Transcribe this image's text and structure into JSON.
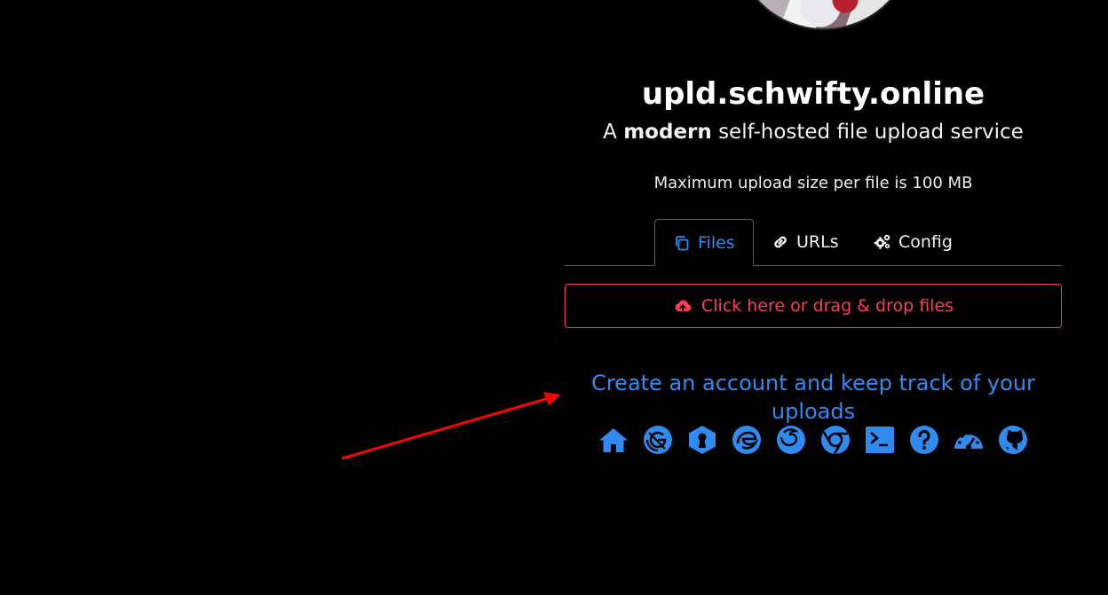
{
  "site": {
    "title": "upld.schwifty.online",
    "tagline_prefix": "A ",
    "tagline_bold": "modern",
    "tagline_suffix": " self-hosted file upload service",
    "max_upload_text": "Maximum upload size per file is 100 MB"
  },
  "tabs": [
    {
      "label": "Files",
      "icon": "copy-icon",
      "active": true
    },
    {
      "label": "URLs",
      "icon": "link-icon",
      "active": false
    },
    {
      "label": "Config",
      "icon": "gears-icon",
      "active": false
    }
  ],
  "upload": {
    "label": "Click here or drag & drop files",
    "icon": "cloud-upload-icon"
  },
  "account_link": {
    "label": "Create an account and keep track of your uploads"
  },
  "quick_links": [
    {
      "icon": "home-icon"
    },
    {
      "icon": "gatsby-icon"
    },
    {
      "icon": "keybase-icon"
    },
    {
      "icon": "edge-icon"
    },
    {
      "icon": "firefox-icon"
    },
    {
      "icon": "chrome-icon"
    },
    {
      "icon": "terminal-icon"
    },
    {
      "icon": "question-icon"
    },
    {
      "icon": "dashboard-icon"
    },
    {
      "icon": "github-icon"
    }
  ],
  "colors": {
    "background": "#000000",
    "accent_blue": "#2f8bf0",
    "upload_red": "#ff3b5c",
    "annotation_arrow": "#ff0000"
  }
}
